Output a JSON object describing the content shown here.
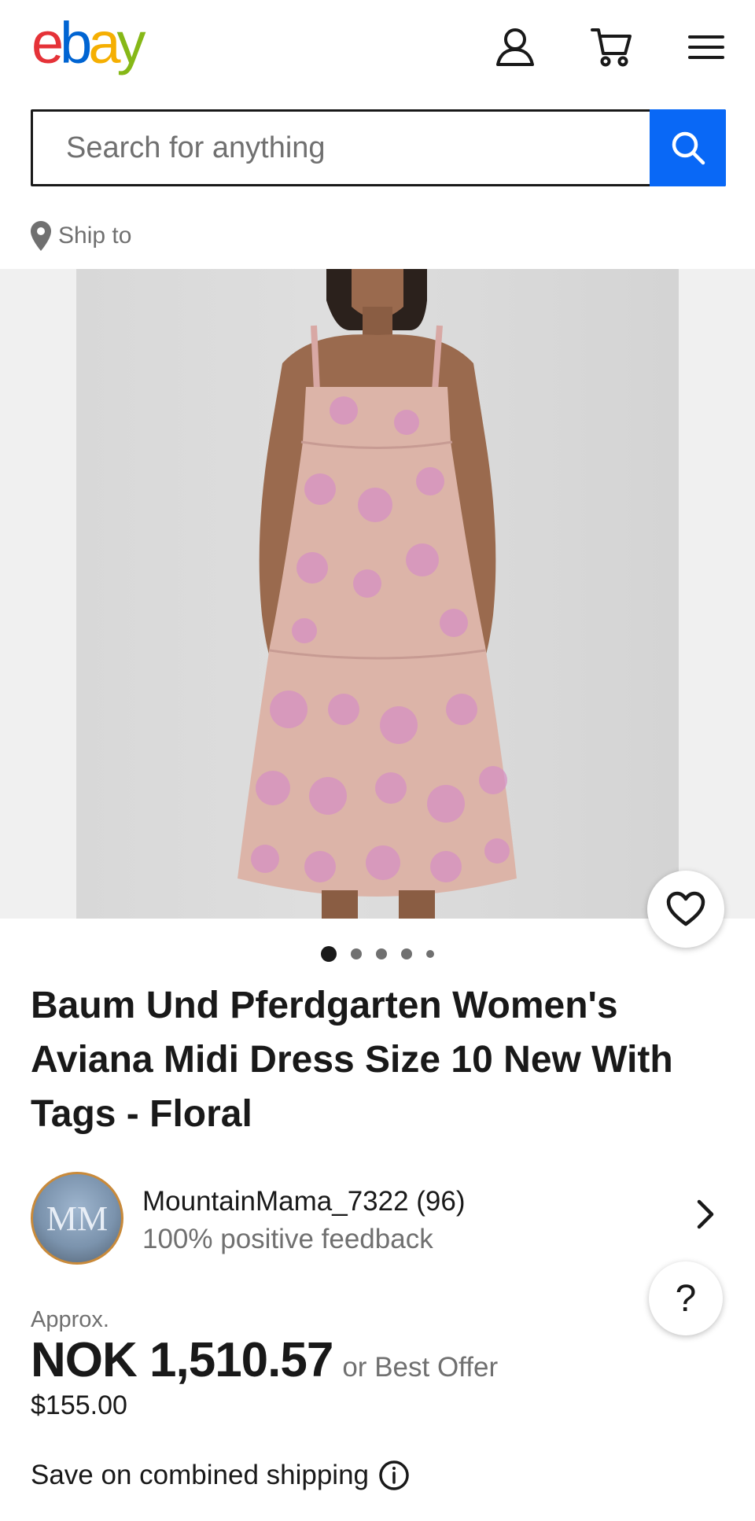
{
  "header": {
    "logo": {
      "e": "e",
      "b": "b",
      "a": "a",
      "y": "y"
    },
    "icons": [
      "user-icon",
      "cart-icon",
      "menu-icon"
    ]
  },
  "search": {
    "placeholder": "Search for anything",
    "button_icon": "search-icon"
  },
  "ship_to": {
    "label": "Ship to",
    "icon": "location-pin-icon"
  },
  "gallery": {
    "image_count": 5,
    "active_index": 0
  },
  "listing": {
    "title": "Baum Und Pferdgarten Women's Aviana Midi Dress Size 10 New With Tags - Floral"
  },
  "seller": {
    "avatar_initials": "MM",
    "name_line": "MountainMama_7322 (96)",
    "feedback": "100% positive feedback"
  },
  "help": {
    "label": "?"
  },
  "price": {
    "approx_label": "Approx.",
    "amount": "NOK 1,510.57",
    "offer": "or Best Offer",
    "original": "$155.00"
  },
  "shipping": {
    "combined_label": "Save on combined shipping",
    "info_icon": "info-icon"
  },
  "colors": {
    "accent": "#0968f6",
    "text": "#191919",
    "muted": "#707070"
  }
}
